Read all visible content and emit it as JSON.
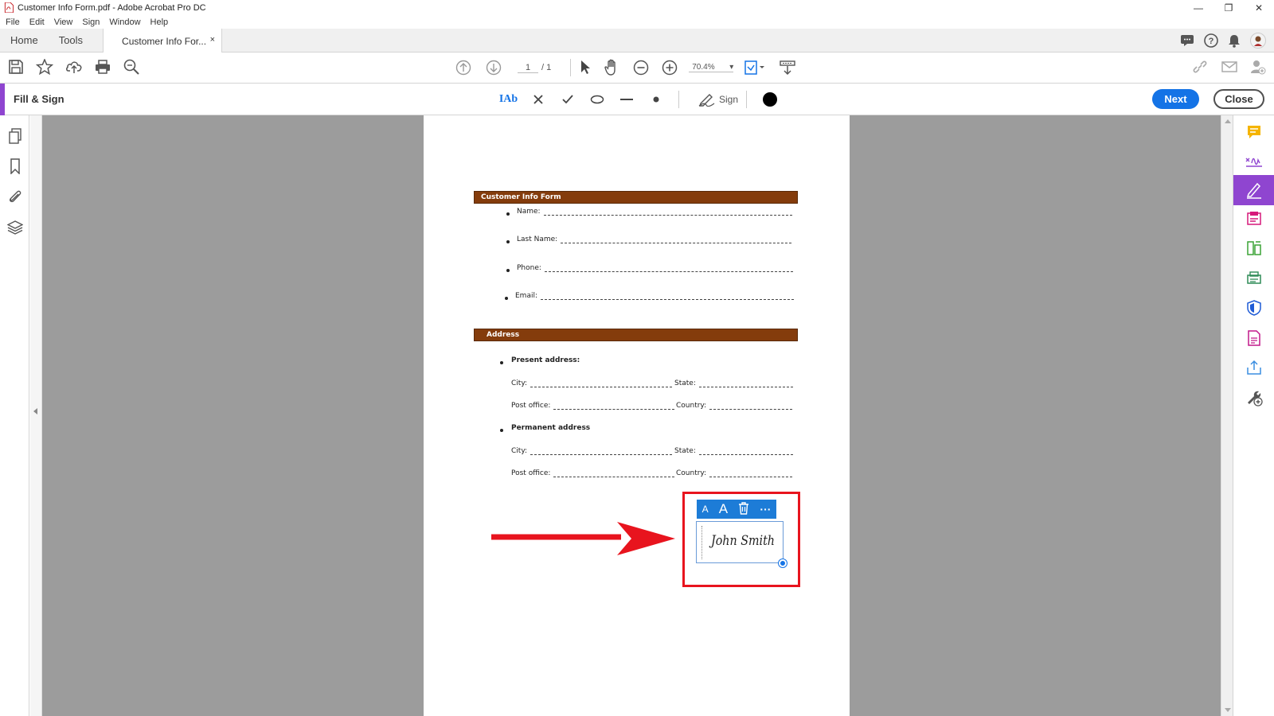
{
  "window": {
    "title": "Customer Info Form.pdf - Adobe Acrobat Pro DC",
    "controls": [
      "minimize",
      "restore",
      "close"
    ]
  },
  "menu": [
    "File",
    "Edit",
    "View",
    "Sign",
    "Window",
    "Help"
  ],
  "tabs": {
    "home": "Home",
    "tools": "Tools",
    "document": "Customer Info For...",
    "close_glyph": "×"
  },
  "toolbar": {
    "page_current": "1",
    "page_total": "/ 1",
    "zoom": "70.4%"
  },
  "fill_sign": {
    "label": "Fill & Sign",
    "text_tool": "IAb",
    "sign_label": "Sign",
    "next_label": "Next",
    "close_label": "Close",
    "color_dot": "#000000"
  },
  "document": {
    "section1_title": "Customer Info Form",
    "fields1": [
      "Name:",
      "Last Name:",
      "Phone:",
      "Email:"
    ],
    "section2_title": "Address",
    "present_heading": "Present address:",
    "permanent_heading": "Permanent address",
    "city": "City:",
    "state": "State:",
    "post_office": "Post office:",
    "country": "Country:",
    "signature_text": "John Smith",
    "sig_toolbar": [
      "A",
      "A",
      "🗑",
      "···"
    ]
  },
  "colors": {
    "accent_purple": "#8f45d0",
    "primary_blue": "#1473e6",
    "section_brown": "#843c0c",
    "annotation_red": "#e8141e"
  }
}
